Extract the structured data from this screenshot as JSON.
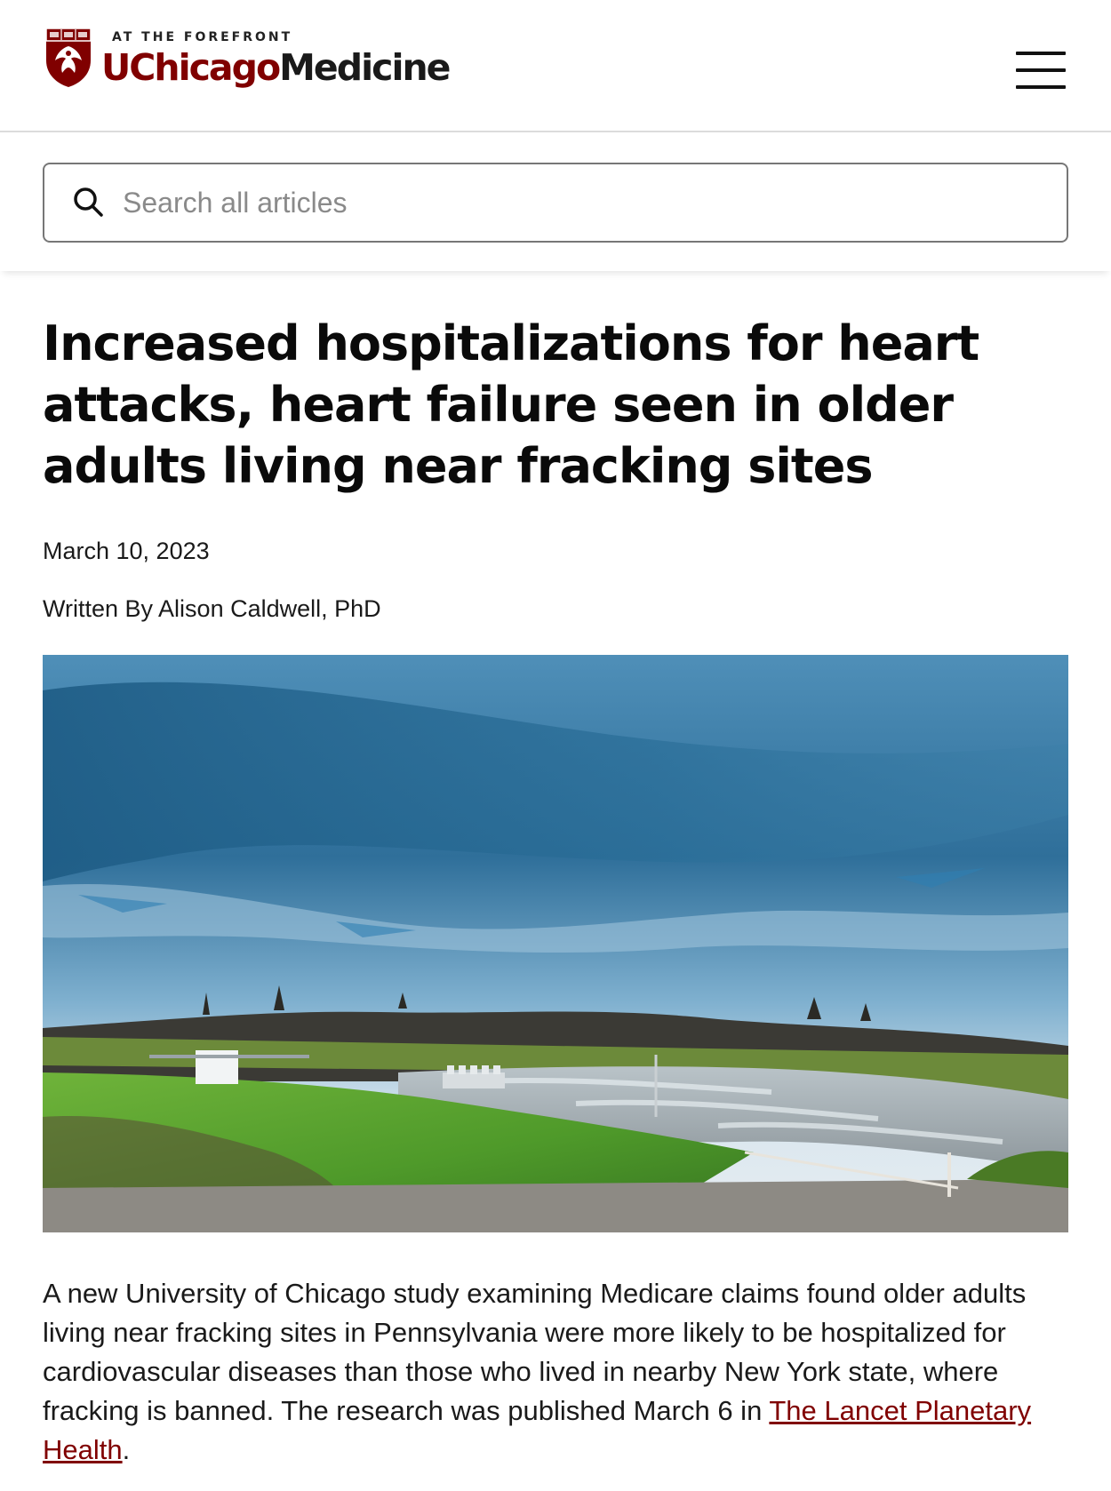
{
  "header": {
    "tagline": "AT THE FOREFRONT",
    "brand_primary": "UChicago",
    "brand_secondary": "Medicine",
    "logo_icon": "phoenix-shield-icon",
    "menu_icon": "hamburger-menu-icon",
    "colors": {
      "brand": "#800000",
      "text": "#111111"
    }
  },
  "search": {
    "placeholder": "Search all articles",
    "value": "",
    "icon": "search-icon"
  },
  "article": {
    "title": "Increased hospitalizations for heart attacks, heart failure seen in older adults living near fracking sites",
    "date": "March 10, 2023",
    "byline": "Written By Alison Caldwell, PhD",
    "body_before_link": "A new University of Chicago study examining Medicare claims found older adults living near fracking sites in Pennsylvania were more likely to be hospitalized for cardiovascular diseases than those who lived in nearby New York state, where fracking is banned. The research was published March 6 in ",
    "link_text": "The Lancet Planetary Health",
    "body_after_link": ".",
    "link_color": "#800000"
  }
}
